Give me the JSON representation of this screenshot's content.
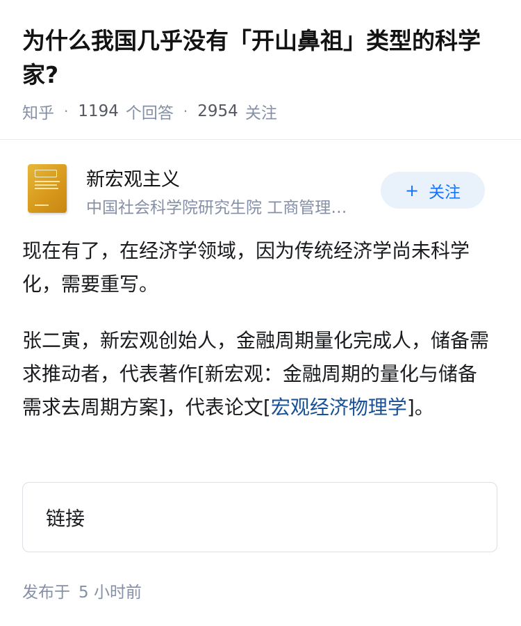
{
  "question": {
    "title": "为什么我国几乎没有「开山鼻祖」类型的科学家?",
    "source": "知乎",
    "separator": "·",
    "answer_count": "1194",
    "answer_label": "个回答",
    "follower_count": "2954",
    "follower_label": "关注"
  },
  "author": {
    "avatar_icon": "book-cover-avatar",
    "name": "新宏观主义",
    "headline": "中国社会科学院研究生院 工商管理硕士",
    "follow_plus": "+",
    "follow_label": "关注"
  },
  "answer": {
    "paragraph1": "现在有了，在经济学领域，因为传统经济学尚未科学化，需要重写。",
    "paragraph2_prefix": "张二寅，新宏观创始人，金融周期量化完成人，储备需求推动者，代表著作[新宏观：金融周期的量化与储备需求去周期方案]，代表论文[",
    "paragraph2_link": "宏观经济物理学",
    "paragraph2_suffix": "]。",
    "link_card_label": "链接"
  },
  "footer": {
    "publish_prefix": "发布于",
    "publish_time": "5 小时前"
  },
  "colors": {
    "title": "#121212",
    "meta": "#8590a6",
    "accent": "#1772f6",
    "link": "#175199",
    "follow_bg": "#e9f1fb"
  }
}
